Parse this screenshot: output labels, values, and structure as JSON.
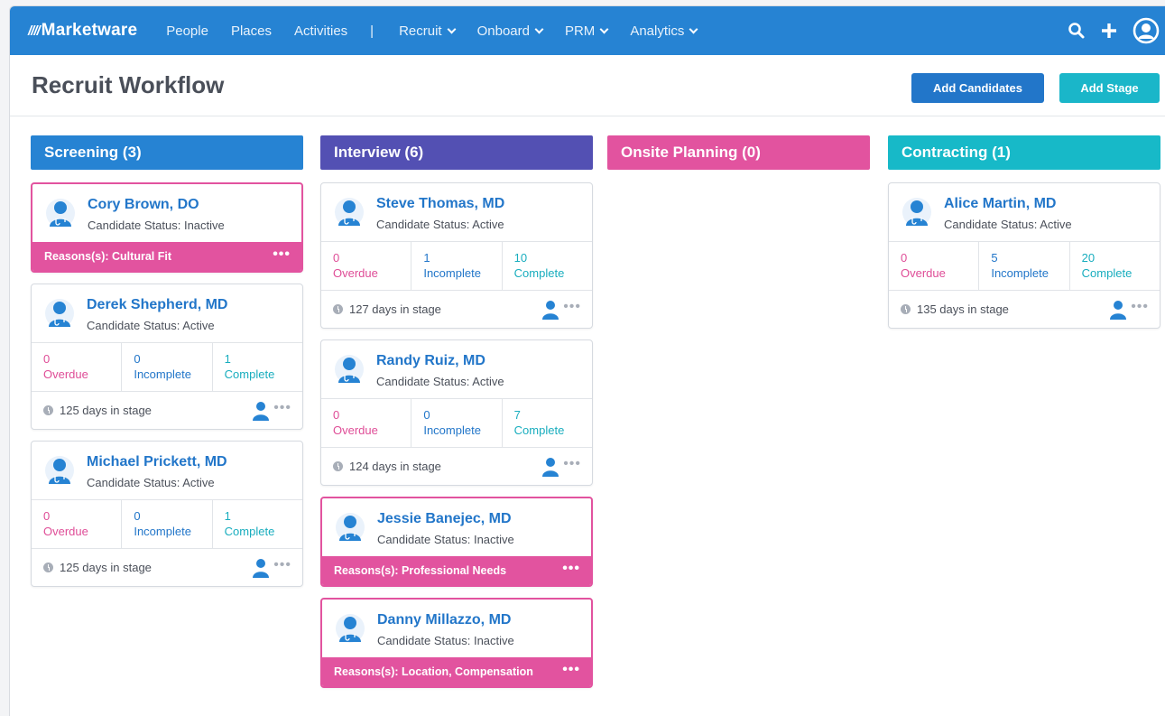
{
  "nav": {
    "logo_mark": "////",
    "logo_text": "Marketware",
    "links": [
      "People",
      "Places",
      "Activities"
    ],
    "separator": "|",
    "menus": [
      "Recruit",
      "Onboard",
      "PRM",
      "Analytics"
    ]
  },
  "header": {
    "title": "Recruit Workflow",
    "add_candidates": "Add Candidates",
    "add_stage": "Add Stage"
  },
  "colors": {
    "screening": "#2683d3",
    "interview": "#5350b3",
    "onsite": "#e2539f",
    "contracting": "#17b9c8"
  },
  "columns": [
    {
      "title": "Screening (3)",
      "cards": [
        {
          "name": "Cory Brown, DO",
          "status": "Candidate Status: Inactive",
          "reason": "Reasons(s): Cultural Fit"
        },
        {
          "name": "Derek Shepherd, MD",
          "status": "Candidate Status: Active",
          "overdue": "0",
          "incomplete": "0",
          "complete": "1",
          "days": "125 days in stage"
        },
        {
          "name": "Michael Prickett, MD",
          "status": "Candidate Status: Active",
          "overdue": "0",
          "incomplete": "0",
          "complete": "1",
          "days": "125 days in stage"
        }
      ]
    },
    {
      "title": "Interview (6)",
      "cards": [
        {
          "name": "Steve Thomas, MD",
          "status": "Candidate Status: Active",
          "overdue": "0",
          "incomplete": "1",
          "complete": "10",
          "days": "127 days in stage"
        },
        {
          "name": "Randy Ruiz, MD",
          "status": "Candidate Status: Active",
          "overdue": "0",
          "incomplete": "0",
          "complete": "7",
          "days": "124 days in stage"
        },
        {
          "name": "Jessie Banejec, MD",
          "status": "Candidate Status: Inactive",
          "reason": "Reasons(s): Professional Needs"
        },
        {
          "name": "Danny Millazzo, MD",
          "status": "Candidate Status: Inactive",
          "reason": "Reasons(s): Location, Compensation"
        }
      ]
    },
    {
      "title": "Onsite Planning (0)",
      "cards": []
    },
    {
      "title": "Contracting (1)",
      "cards": [
        {
          "name": "Alice Martin, MD",
          "status": "Candidate Status: Active",
          "overdue": "0",
          "incomplete": "5",
          "complete": "20",
          "days": "135 days in stage"
        }
      ]
    }
  ],
  "labels": {
    "overdue": "Overdue",
    "incomplete": "Incomplete",
    "complete": "Complete",
    "more": "•••"
  }
}
